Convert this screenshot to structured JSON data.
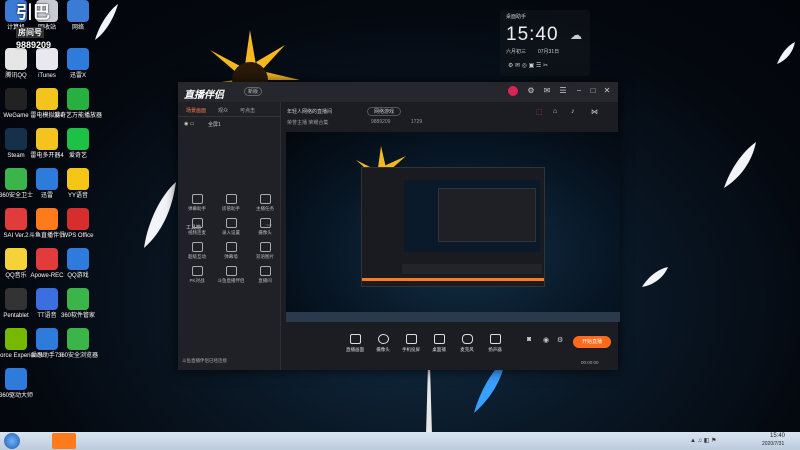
{
  "desktop_icons": [
    {
      "label": "计算机",
      "color": "#3a7bd5"
    },
    {
      "label": "回收站",
      "color": "#c8ccd2"
    },
    {
      "label": "网络",
      "color": "#3a7bd5"
    },
    {
      "label": "腾讯QQ",
      "color": "#e6e6e6"
    },
    {
      "label": "iTunes",
      "color": "#e8e8ee"
    },
    {
      "label": "迅雷X",
      "color": "#2e7bdb"
    },
    {
      "label": "WeGame",
      "color": "#222"
    },
    {
      "label": "雷电模拟器4",
      "color": "#f2c41d"
    },
    {
      "label": "爱奇艺万能播放器",
      "color": "#27b03f"
    },
    {
      "label": "Steam",
      "color": "#16304c"
    },
    {
      "label": "雷电多开器4",
      "color": "#f2c41d"
    },
    {
      "label": "爱奇艺",
      "color": "#1dc146"
    },
    {
      "label": "360安全卫士",
      "color": "#3bb54a"
    },
    {
      "label": "迅雷",
      "color": "#2e7bdb"
    },
    {
      "label": "YY语音",
      "color": "#f5c518"
    },
    {
      "label": "SAI Ver.2",
      "color": "#e23b3b"
    },
    {
      "label": "斗鱼直播伴侣",
      "color": "#ff7a1a"
    },
    {
      "label": "WPS Office",
      "color": "#d62d2d"
    },
    {
      "label": "QQ音乐",
      "color": "#f5d23a"
    },
    {
      "label": "Apowe-REC",
      "color": "#e23b3b"
    },
    {
      "label": "QQ游戏",
      "color": "#2e7bdb"
    },
    {
      "label": "Pentablet",
      "color": "#333"
    },
    {
      "label": "TT语音",
      "color": "#3b6fe0"
    },
    {
      "label": "360软件管家",
      "color": "#3bb54a"
    },
    {
      "label": "GeForce Experience",
      "color": "#76b900"
    },
    {
      "label": "爱思助手7.0",
      "color": "#2e7bdb"
    },
    {
      "label": "360安全浏览器",
      "color": "#3bb54a"
    },
    {
      "label": "360驱动大师",
      "color": "#2e7bdb"
    }
  ],
  "overlay": {
    "line1": "引巴",
    "line2": "房间号",
    "line3": "9889209"
  },
  "widget": {
    "title": "桌面助手",
    "time": "15:40",
    "weekday": "六月初三",
    "date": "07月31日"
  },
  "app": {
    "title": "直播伴侣",
    "badge": "新版",
    "left_tabs": [
      "场景画面",
      "观众",
      "可点击"
    ],
    "scene_name": "全屏1",
    "toolbox_title": "工具箱",
    "tools": [
      "弹幕助手",
      "房管助手",
      "主播任务",
      "视频连麦",
      "录入设置",
      "摄像头",
      "超级互动",
      "弹幕墙",
      "双语图片",
      "PK对战",
      "斗鱼直播伴侣",
      "直播间"
    ],
    "notice": "斗鱼直播伴侣已经连接",
    "room_title": "年轻人网络的直播间",
    "room_tag": "网络游戏",
    "room_line": "荣誉主播  荣耀合集",
    "room_id": "9889209",
    "fans": "1729",
    "controls": [
      "直播画面",
      "摄像头",
      "手机投屏",
      "桌面捕",
      "麦克风",
      "扬声器"
    ],
    "start_label": "开始直播",
    "timer": "00:00:00"
  },
  "taskbar": {
    "time": "15:40",
    "date": "2020/7/31"
  }
}
